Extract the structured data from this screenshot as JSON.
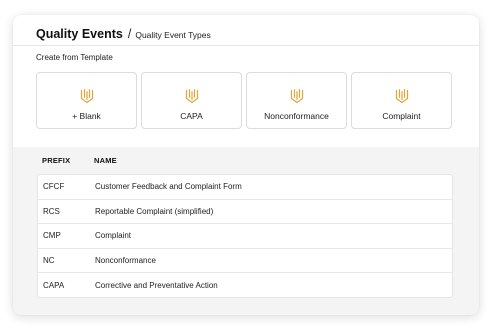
{
  "header": {
    "title": "Quality Events",
    "separator": "/",
    "subtitle": "Quality Event Types"
  },
  "section": {
    "label": "Create from Template"
  },
  "templates": [
    {
      "label": "+ Blank",
      "icon": "template-icon"
    },
    {
      "label": "CAPA",
      "icon": "template-icon"
    },
    {
      "label": "Nonconformance",
      "icon": "template-icon"
    },
    {
      "label": "Complaint",
      "icon": "template-icon"
    }
  ],
  "accent_color": "#e0a43a",
  "table": {
    "columns": [
      "PREFIX",
      "NAME"
    ],
    "rows": [
      {
        "prefix": "CFCF",
        "name": "Customer Feedback and Complaint Form"
      },
      {
        "prefix": "RCS",
        "name": "Reportable Complaint (simplified)"
      },
      {
        "prefix": "CMP",
        "name": "Complaint"
      },
      {
        "prefix": "NC",
        "name": "Nonconformance"
      },
      {
        "prefix": "CAPA",
        "name": "Corrective and Preventative Action"
      }
    ]
  }
}
